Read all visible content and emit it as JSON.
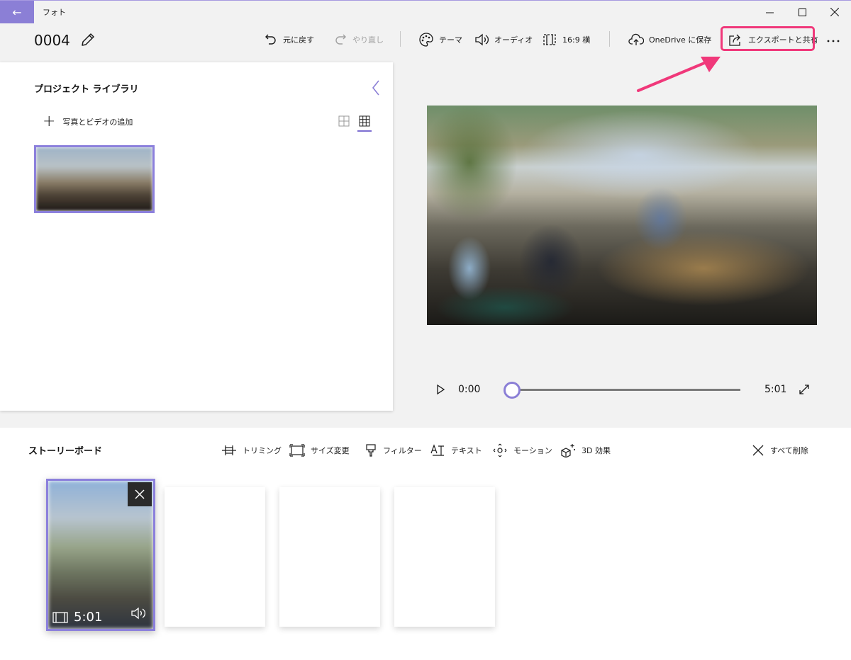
{
  "window": {
    "app_title": "フォト",
    "back_icon": "back-arrow-icon",
    "accent_color": "#8b7fd6"
  },
  "toolbar": {
    "project_title": "0004",
    "undo_label": "元に戻す",
    "redo_label": "やり直し",
    "theme_label": "テーマ",
    "audio_label": "オーディオ",
    "aspect_label": "16:9 横",
    "onedrive_label": "OneDrive に保存",
    "export_label": "エクスポートと共有",
    "highlight_color": "#f0387a"
  },
  "library": {
    "title": "プロジェクト ライブラリ",
    "add_label": "写真とビデオの追加"
  },
  "player": {
    "current_time": "0:00",
    "duration": "5:01",
    "progress": 0
  },
  "storyboard": {
    "title": "ストーリーボード",
    "tools": {
      "trim": "トリミング",
      "resize": "サイズ変更",
      "filter": "フィルター",
      "text": "テキスト",
      "motion": "モーション",
      "effects3d": "3D 効果",
      "delete_all": "すべて削除"
    },
    "clip": {
      "duration": "5:01"
    }
  }
}
